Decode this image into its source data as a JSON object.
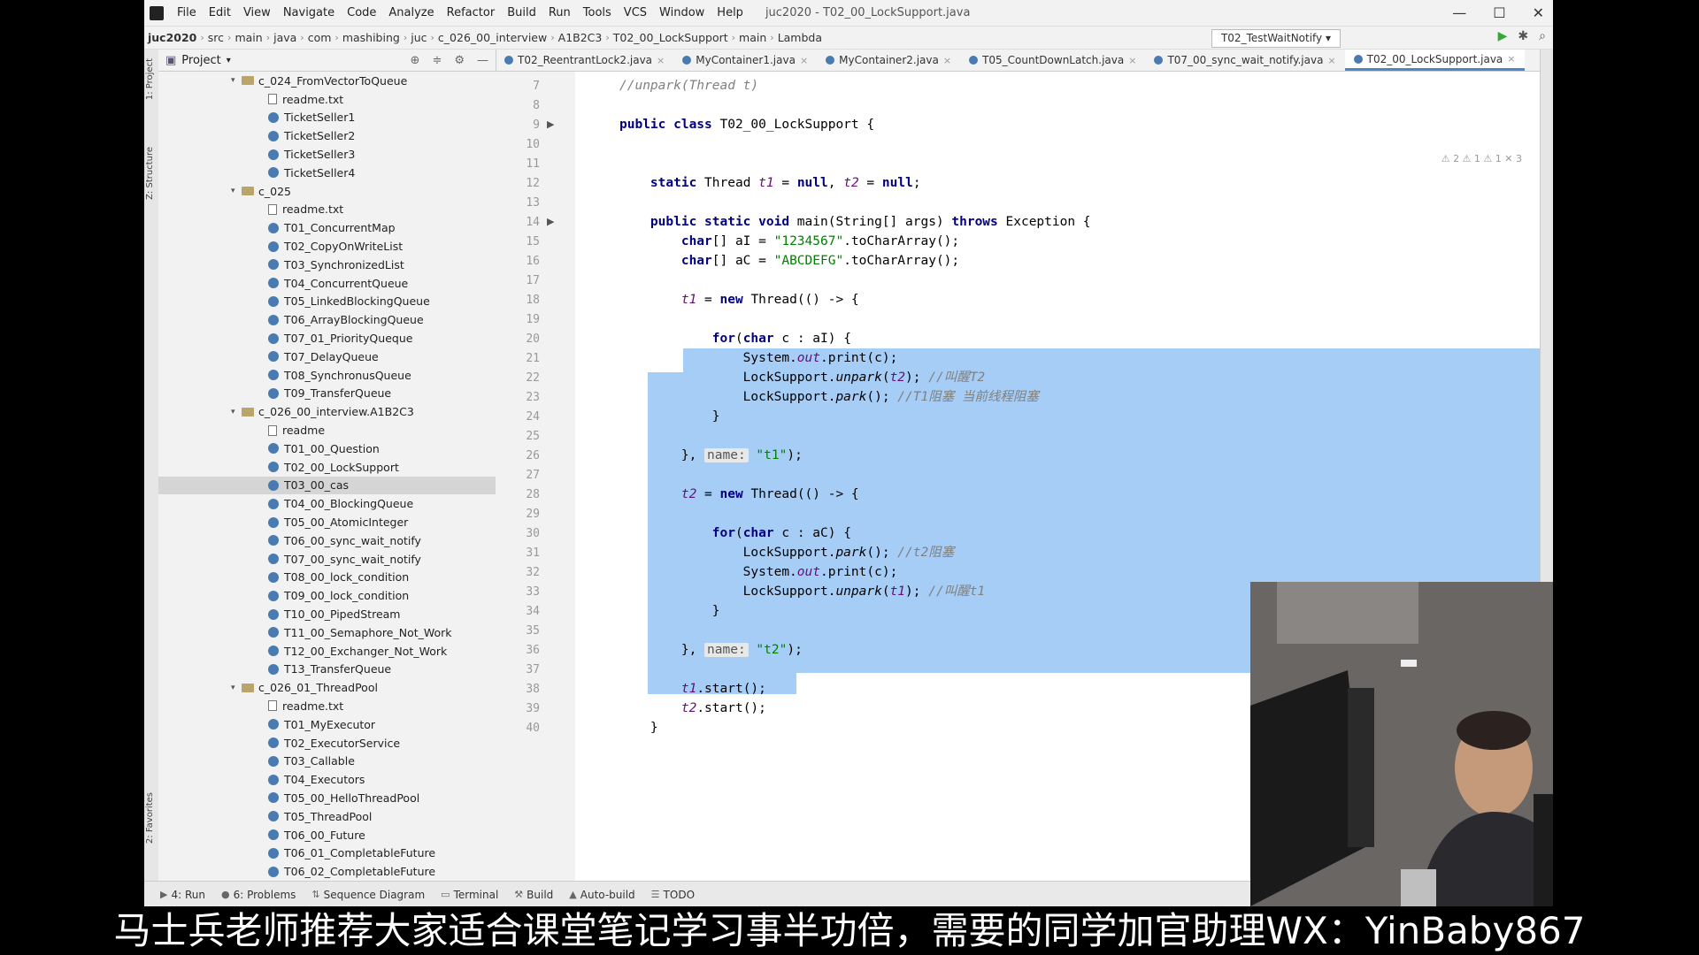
{
  "menubar": {
    "items": [
      "File",
      "Edit",
      "View",
      "Navigate",
      "Code",
      "Analyze",
      "Refactor",
      "Build",
      "Run",
      "Tools",
      "VCS",
      "Window",
      "Help"
    ],
    "window_title": "juc2020 - T02_00_LockSupport.java",
    "minimize": "—",
    "maximize": "☐",
    "close": "✕"
  },
  "navbar": {
    "crumbs": [
      "juc2020",
      "src",
      "main",
      "java",
      "com",
      "mashibing",
      "juc",
      "c_026_00_interview",
      "A1B2C3",
      "T02_00_LockSupport",
      "main",
      "Lambda"
    ],
    "run_config": "T02_TestWaitNotify ▾"
  },
  "left_strip": {
    "project": "1: Project",
    "structure": "Z: Structure",
    "favorites": "2: Favorites"
  },
  "project": {
    "title": "Project",
    "tree": [
      {
        "indent": 0,
        "type": "folder",
        "label": "c_024_FromVectorToQueue"
      },
      {
        "indent": 1,
        "type": "txt",
        "label": "readme.txt"
      },
      {
        "indent": 1,
        "type": "class",
        "label": "TicketSeller1"
      },
      {
        "indent": 1,
        "type": "class",
        "label": "TicketSeller2"
      },
      {
        "indent": 1,
        "type": "class",
        "label": "TicketSeller3"
      },
      {
        "indent": 1,
        "type": "class",
        "label": "TicketSeller4"
      },
      {
        "indent": 0,
        "type": "folder",
        "label": "c_025"
      },
      {
        "indent": 1,
        "type": "txt",
        "label": "readme.txt"
      },
      {
        "indent": 1,
        "type": "class",
        "label": "T01_ConcurrentMap"
      },
      {
        "indent": 1,
        "type": "class",
        "label": "T02_CopyOnWriteList"
      },
      {
        "indent": 1,
        "type": "class",
        "label": "T03_SynchronizedList"
      },
      {
        "indent": 1,
        "type": "class",
        "label": "T04_ConcurrentQueue"
      },
      {
        "indent": 1,
        "type": "class",
        "label": "T05_LinkedBlockingQueue"
      },
      {
        "indent": 1,
        "type": "class",
        "label": "T06_ArrayBlockingQueue"
      },
      {
        "indent": 1,
        "type": "class",
        "label": "T07_01_PriorityQueque"
      },
      {
        "indent": 1,
        "type": "class",
        "label": "T07_DelayQueue"
      },
      {
        "indent": 1,
        "type": "class",
        "label": "T08_SynchronusQueue"
      },
      {
        "indent": 1,
        "type": "class",
        "label": "T09_TransferQueue"
      },
      {
        "indent": 0,
        "type": "folder",
        "label": "c_026_00_interview.A1B2C3"
      },
      {
        "indent": 1,
        "type": "txt",
        "label": "readme"
      },
      {
        "indent": 1,
        "type": "class",
        "label": "T01_00_Question"
      },
      {
        "indent": 1,
        "type": "class",
        "label": "T02_00_LockSupport"
      },
      {
        "indent": 1,
        "type": "class",
        "label": "T03_00_cas",
        "selected": true
      },
      {
        "indent": 1,
        "type": "class",
        "label": "T04_00_BlockingQueue"
      },
      {
        "indent": 1,
        "type": "class",
        "label": "T05_00_AtomicInteger"
      },
      {
        "indent": 1,
        "type": "class",
        "label": "T06_00_sync_wait_notify"
      },
      {
        "indent": 1,
        "type": "class",
        "label": "T07_00_sync_wait_notify"
      },
      {
        "indent": 1,
        "type": "class",
        "label": "T08_00_lock_condition"
      },
      {
        "indent": 1,
        "type": "class",
        "label": "T09_00_lock_condition"
      },
      {
        "indent": 1,
        "type": "class",
        "label": "T10_00_PipedStream"
      },
      {
        "indent": 1,
        "type": "class",
        "label": "T11_00_Semaphore_Not_Work"
      },
      {
        "indent": 1,
        "type": "class",
        "label": "T12_00_Exchanger_Not_Work"
      },
      {
        "indent": 1,
        "type": "class",
        "label": "T13_TransferQueue"
      },
      {
        "indent": 0,
        "type": "folder",
        "label": "c_026_01_ThreadPool"
      },
      {
        "indent": 1,
        "type": "txt",
        "label": "readme.txt"
      },
      {
        "indent": 1,
        "type": "class",
        "label": "T01_MyExecutor"
      },
      {
        "indent": 1,
        "type": "class",
        "label": "T02_ExecutorService"
      },
      {
        "indent": 1,
        "type": "class",
        "label": "T03_Callable"
      },
      {
        "indent": 1,
        "type": "class",
        "label": "T04_Executors"
      },
      {
        "indent": 1,
        "type": "class",
        "label": "T05_00_HelloThreadPool"
      },
      {
        "indent": 1,
        "type": "class",
        "label": "T05_ThreadPool"
      },
      {
        "indent": 1,
        "type": "class",
        "label": "T06_00_Future"
      },
      {
        "indent": 1,
        "type": "class",
        "label": "T06_01_CompletableFuture"
      },
      {
        "indent": 1,
        "type": "class",
        "label": "T06_02_CompletableFuture"
      }
    ]
  },
  "tabs": [
    {
      "label": "T02_ReentrantLock2.java",
      "active": false
    },
    {
      "label": "MyContainer1.java",
      "active": false
    },
    {
      "label": "MyContainer2.java",
      "active": false
    },
    {
      "label": "T05_CountDownLatch.java",
      "active": false
    },
    {
      "label": "T07_00_sync_wait_notify.java",
      "active": false
    },
    {
      "label": "T02_00_LockSupport.java",
      "active": true
    }
  ],
  "inspection_summary": "⚠ 2  ⚠ 1  ⚠ 1  ✕ 3",
  "code": [
    {
      "n": "7",
      "html": "<span class='cm'>//unpark(Thread t)</span>"
    },
    {
      "n": "8",
      "html": ""
    },
    {
      "n": "9",
      "html": "<span class='kw'>public class</span> T02_00_LockSupport {"
    },
    {
      "n": "10",
      "html": ""
    },
    {
      "n": "11",
      "html": ""
    },
    {
      "n": "12",
      "html": "    <span class='kw'>static</span> Thread <span class='fld'>t1</span> = <span class='kw'>null</span>, <span class='fld'>t2</span> = <span class='kw'>null</span>;"
    },
    {
      "n": "13",
      "html": ""
    },
    {
      "n": "14",
      "html": "    <span class='kw'>public static void</span> main(String[] args) <span class='kw'>throws</span> Exception {"
    },
    {
      "n": "15",
      "html": "        <span class='kw'>char</span>[] aI = <span class='st'>\"1234567\"</span>.toCharArray();"
    },
    {
      "n": "16",
      "html": "        <span class='kw'>char</span>[] aC = <span class='st'>\"ABCDEFG\"</span>.toCharArray();"
    },
    {
      "n": "17",
      "html": ""
    },
    {
      "n": "18",
      "html": "        <span class='fld'>t1</span> = <span class='kw'>new</span> Thread(() -> {"
    },
    {
      "n": "19",
      "html": ""
    },
    {
      "n": "20",
      "html": "            <span class='kw'>for</span>(<span class='kw'>char</span> c : aI) {"
    },
    {
      "n": "21",
      "html": "                System.<span class='fld'>out</span>.print(c);"
    },
    {
      "n": "22",
      "html": "                LockSupport.<i>unpark</i>(<span class='fld'>t2</span>); <span class='cm'>//叫醒T2</span>"
    },
    {
      "n": "23",
      "html": "                LockSupport.<i>park</i>(); <span class='cm'>//T1阻塞 当前线程阻塞</span>"
    },
    {
      "n": "24",
      "html": "            }"
    },
    {
      "n": "25",
      "html": ""
    },
    {
      "n": "26",
      "html": "        }, <span class='hint'>name:</span> <span class='st'>\"t1\"</span>);"
    },
    {
      "n": "27",
      "html": ""
    },
    {
      "n": "28",
      "html": "        <span class='fld'>t2</span> = <span class='kw'>new</span> Thread(() -> {"
    },
    {
      "n": "29",
      "html": ""
    },
    {
      "n": "30",
      "html": "            <span class='kw'>for</span>(<span class='kw'>char</span> c : aC) {"
    },
    {
      "n": "31",
      "html": "                LockSupport.<i>park</i>(); <span class='cm'>//t2阻塞</span>"
    },
    {
      "n": "32",
      "html": "                System.<span class='fld'>out</span>.print(c);"
    },
    {
      "n": "33",
      "html": "                LockSupport.<i>unpark</i>(<span class='fld'>t1</span>); <span class='cm'>//叫醒t1</span>"
    },
    {
      "n": "34",
      "html": "            }"
    },
    {
      "n": "35",
      "html": ""
    },
    {
      "n": "36",
      "html": "        }, <span class='hint'>name:</span> <span class='st'>\"t2\"</span>);"
    },
    {
      "n": "37",
      "html": ""
    },
    {
      "n": "38",
      "html": "        <span class='fld'>t1</span>.start();"
    },
    {
      "n": "39",
      "html": "        <span class='fld'>t2</span>.start();"
    },
    {
      "n": "40",
      "html": "    }"
    }
  ],
  "bottombar": {
    "tools": [
      "4: Run",
      "6: Problems",
      "Sequence Diagram",
      "Terminal",
      "Build",
      "Auto-build",
      "TODO"
    ]
  },
  "caption": "马士兵老师推荐大家适合课堂笔记学习事半功倍，需要的同学加官助理WX：YinBaby867"
}
